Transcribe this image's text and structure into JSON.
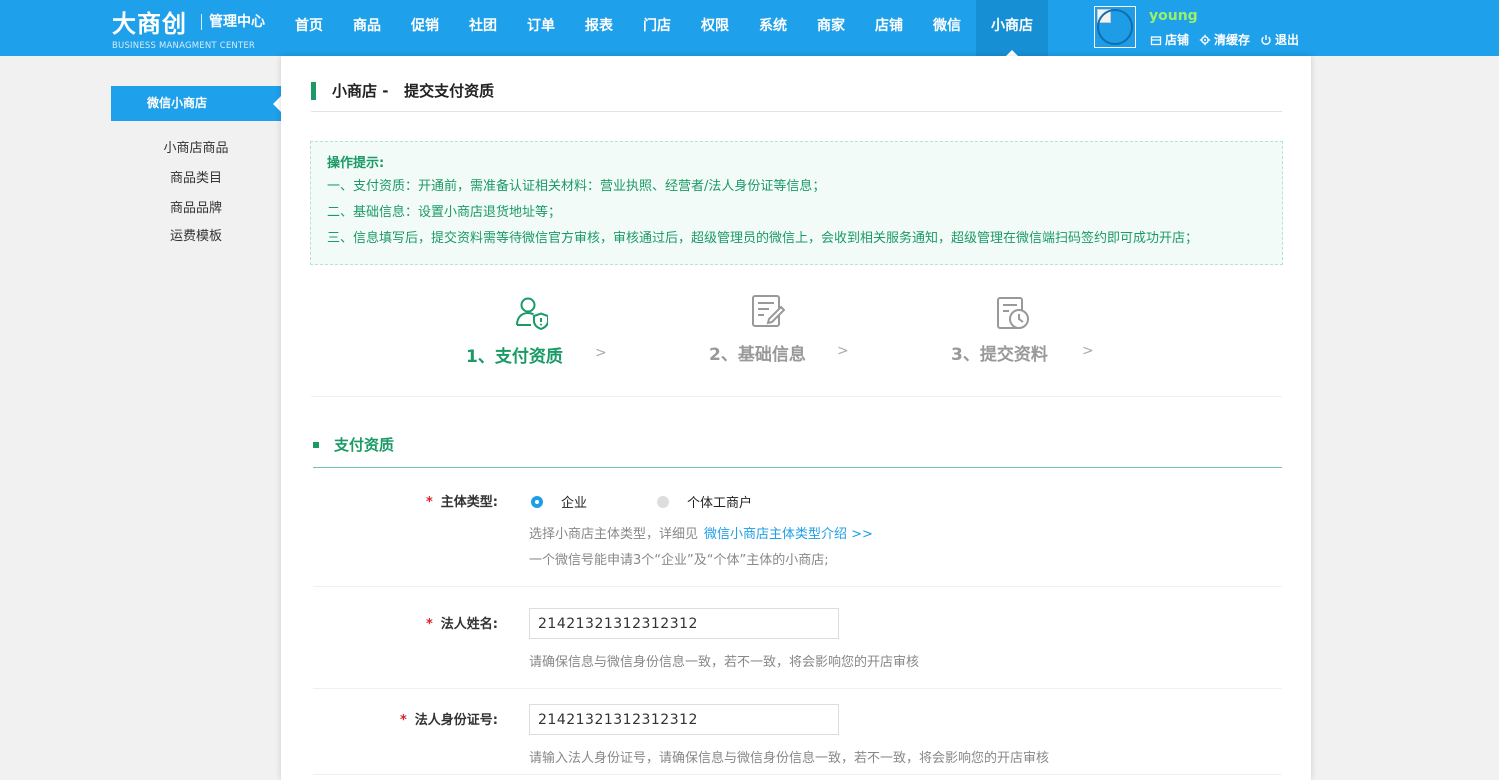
{
  "header": {
    "logo": "大商创",
    "logo_sub": "管理中心",
    "logo_en": "BUSINESS MANAGMENT CENTER",
    "nav": [
      "首页",
      "商品",
      "促销",
      "社团",
      "订单",
      "报表",
      "门店",
      "权限",
      "系统",
      "商家",
      "店铺",
      "微信",
      "小商店"
    ],
    "active_nav": "小商店",
    "username": "young",
    "links": {
      "shop": "店铺",
      "clear_cache": "清缓存",
      "logout": "退出"
    },
    "colors": {
      "bar": "#1ea0ea",
      "active": "#178fd5",
      "username": "#9bf06a"
    }
  },
  "sidebar": {
    "active": "微信小商店",
    "items": [
      "小商店商品",
      "商品类目",
      "商品品牌",
      "运费模板"
    ]
  },
  "page": {
    "title": "小商店 -   提交支付资质"
  },
  "tips": {
    "title": "操作提示:",
    "lines": [
      "一、支付资质：开通前，需准备认证相关材料：营业执照、经营者/法人身份证等信息；",
      "二、基础信息：设置小商店退货地址等；",
      "三、信息填写后，提交资料需等待微信官方审核，审核通过后，超级管理员的微信上，会收到相关服务通知，超级管理在微信端扫码签约即可成功开店；"
    ]
  },
  "steps": [
    {
      "label": "1、支付资质",
      "icon": "user-shield-icon",
      "active": true
    },
    {
      "label": "2、基础信息",
      "icon": "edit-document-icon",
      "active": false
    },
    {
      "label": "3、提交资料",
      "icon": "clock-document-icon",
      "active": false
    }
  ],
  "form": {
    "section_title": "支付资质",
    "required_mark": "*",
    "subject_type": {
      "label": "主体类型:",
      "options": [
        "企业",
        "个体工商户"
      ],
      "selected": "企业",
      "hint1": "选择小商店主体类型，详细见",
      "hint_link": "微信小商店主体类型介绍 >>",
      "hint2": "一个微信号能申请3个“企业”及“个体”主体的小商店;"
    },
    "legal_name": {
      "label": "法人姓名:",
      "value": "21421321312312312",
      "hint": "请确保信息与微信身份信息一致，若不一致，将会影响您的开店审核"
    },
    "legal_id": {
      "label": "法人身份证号:",
      "value": "21421321312312312",
      "hint": "请输入法人身份证号，请确保信息与微信身份信息一致，若不一致，将会影响您的开店审核"
    }
  },
  "colors": {
    "green": "#1b9a66",
    "blue": "#1e9ee6",
    "required": "#e02020"
  }
}
